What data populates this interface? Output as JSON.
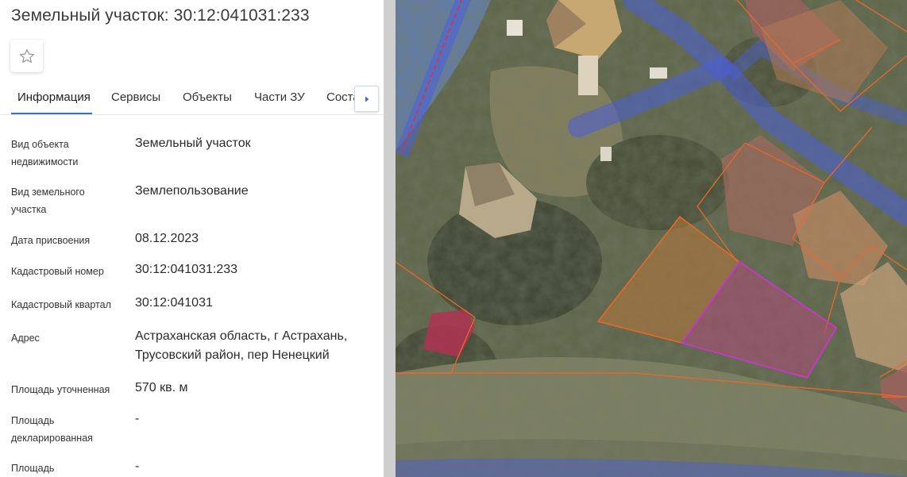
{
  "header": {
    "title": "Земельный участок: 30:12:041031:233"
  },
  "tabs": [
    {
      "label": "Информация",
      "active": true
    },
    {
      "label": "Сервисы",
      "active": false
    },
    {
      "label": "Объекты",
      "active": false
    },
    {
      "label": "Части ЗУ",
      "active": false
    },
    {
      "label": "Состав ЗУ",
      "active": false
    }
  ],
  "info": {
    "rows": [
      {
        "label": "Вид объекта недвижимости",
        "value": "Земельный участок"
      },
      {
        "label": "Вид земельного участка",
        "value": "Землепользование"
      },
      {
        "label": "Дата присвоения",
        "value": "08.12.2023"
      },
      {
        "label": "Кадастровый номер",
        "value": "30:12:041031:233"
      },
      {
        "label": "Кадастровый квартал",
        "value": "30:12:041031"
      },
      {
        "label": "Адрес",
        "value": "Астраханская область, г Астрахань, Трусовский район, пер Ненецкий"
      },
      {
        "label": "Площадь уточненная",
        "value": "570 кв. м"
      },
      {
        "label": "Площадь декларированная",
        "value": "-"
      },
      {
        "label": "Площадь",
        "value": "-"
      }
    ]
  },
  "icons": {
    "favorite": "star-outline-icon",
    "tabs_next": "caret-right-icon"
  },
  "colors": {
    "accent": "#2f6fd6",
    "selected_parcel": "#c03cc0",
    "parcel_outline": "#e8682c",
    "road_overlay": "#4a5fd8"
  }
}
